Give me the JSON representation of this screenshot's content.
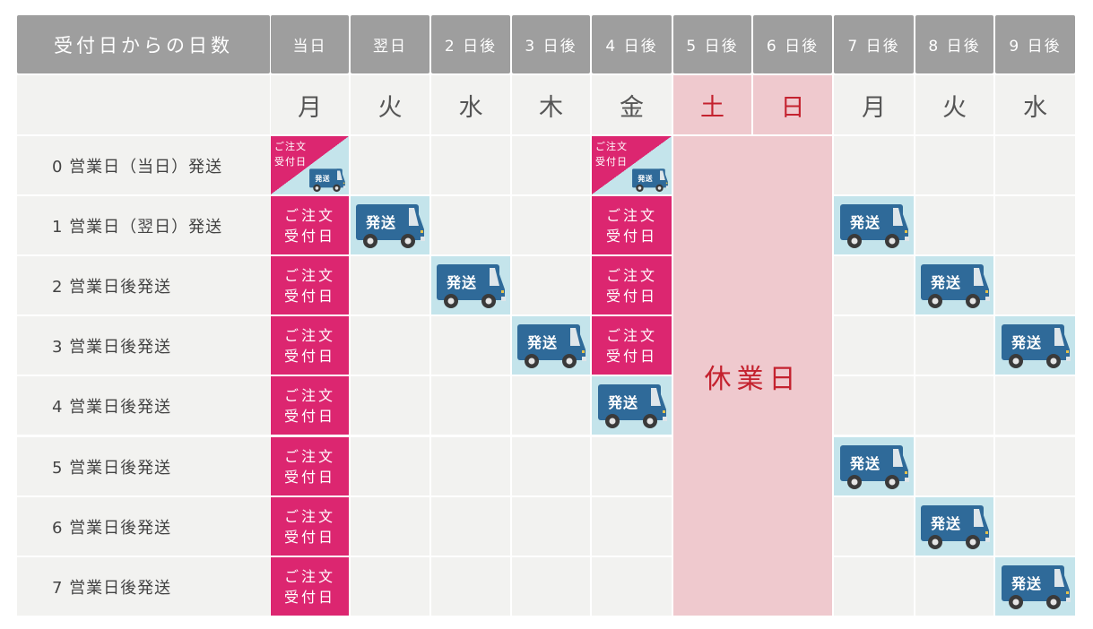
{
  "header": {
    "title": "受付日からの日数",
    "columns": [
      "当日",
      "翌日",
      "2 日後",
      "3 日後",
      "4 日後",
      "5 日後",
      "6 日後",
      "7 日後",
      "8 日後",
      "9 日後"
    ]
  },
  "weekdays": [
    "月",
    "火",
    "水",
    "木",
    "金",
    "土",
    "日",
    "月",
    "火",
    "水"
  ],
  "holiday_columns": [
    5,
    6
  ],
  "holiday_label": "休業日",
  "order_label_line1": "ご注文",
  "order_label_line2": "受付日",
  "ship_label": "発送",
  "colors": {
    "header_bg": "#9e9e9e",
    "order_accent": "#dc2670",
    "ship_bg": "#c4e4eb",
    "truck": "#2f6a99",
    "holiday_bg": "#efc9ce",
    "holiday_text": "#c4222f"
  },
  "rows": [
    {
      "label": "0 営業日（当日）発送",
      "cells": [
        "same",
        "",
        "",
        "",
        "same",
        "",
        "",
        "",
        "",
        ""
      ]
    },
    {
      "label": "1 営業日（翌日）発送",
      "cells": [
        "order",
        "ship",
        "",
        "",
        "order",
        "",
        "",
        "ship",
        "",
        ""
      ]
    },
    {
      "label": "2 営業日後発送",
      "cells": [
        "order",
        "",
        "ship",
        "",
        "order",
        "",
        "",
        "",
        "ship",
        ""
      ]
    },
    {
      "label": "3 営業日後発送",
      "cells": [
        "order",
        "",
        "",
        "ship",
        "order",
        "",
        "",
        "",
        "",
        "ship"
      ]
    },
    {
      "label": "4 営業日後発送",
      "cells": [
        "order",
        "",
        "",
        "",
        "ship",
        "",
        "",
        "",
        "",
        ""
      ]
    },
    {
      "label": "5 営業日後発送",
      "cells": [
        "order",
        "",
        "",
        "",
        "",
        "",
        "",
        "ship",
        "",
        ""
      ]
    },
    {
      "label": "6 営業日後発送",
      "cells": [
        "order",
        "",
        "",
        "",
        "",
        "",
        "",
        "",
        "ship",
        ""
      ]
    },
    {
      "label": "7 営業日後発送",
      "cells": [
        "order",
        "",
        "",
        "",
        "",
        "",
        "",
        "",
        "",
        "ship"
      ]
    }
  ]
}
